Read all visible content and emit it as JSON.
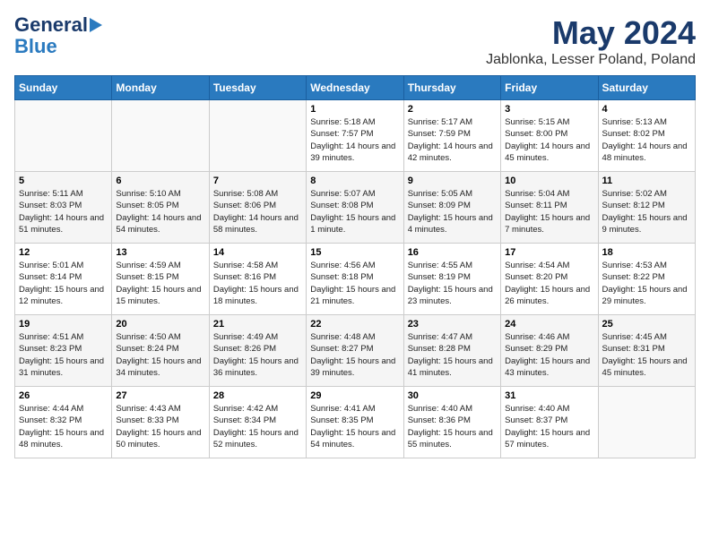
{
  "header": {
    "logo_general": "General",
    "logo_blue": "Blue",
    "month": "May 2024",
    "location": "Jablonka, Lesser Poland, Poland"
  },
  "weekdays": [
    "Sunday",
    "Monday",
    "Tuesday",
    "Wednesday",
    "Thursday",
    "Friday",
    "Saturday"
  ],
  "weeks": [
    [
      {
        "day": "",
        "info": ""
      },
      {
        "day": "",
        "info": ""
      },
      {
        "day": "",
        "info": ""
      },
      {
        "day": "1",
        "info": "Sunrise: 5:18 AM\nSunset: 7:57 PM\nDaylight: 14 hours\nand 39 minutes."
      },
      {
        "day": "2",
        "info": "Sunrise: 5:17 AM\nSunset: 7:59 PM\nDaylight: 14 hours\nand 42 minutes."
      },
      {
        "day": "3",
        "info": "Sunrise: 5:15 AM\nSunset: 8:00 PM\nDaylight: 14 hours\nand 45 minutes."
      },
      {
        "day": "4",
        "info": "Sunrise: 5:13 AM\nSunset: 8:02 PM\nDaylight: 14 hours\nand 48 minutes."
      }
    ],
    [
      {
        "day": "5",
        "info": "Sunrise: 5:11 AM\nSunset: 8:03 PM\nDaylight: 14 hours\nand 51 minutes."
      },
      {
        "day": "6",
        "info": "Sunrise: 5:10 AM\nSunset: 8:05 PM\nDaylight: 14 hours\nand 54 minutes."
      },
      {
        "day": "7",
        "info": "Sunrise: 5:08 AM\nSunset: 8:06 PM\nDaylight: 14 hours\nand 58 minutes."
      },
      {
        "day": "8",
        "info": "Sunrise: 5:07 AM\nSunset: 8:08 PM\nDaylight: 15 hours\nand 1 minute."
      },
      {
        "day": "9",
        "info": "Sunrise: 5:05 AM\nSunset: 8:09 PM\nDaylight: 15 hours\nand 4 minutes."
      },
      {
        "day": "10",
        "info": "Sunrise: 5:04 AM\nSunset: 8:11 PM\nDaylight: 15 hours\nand 7 minutes."
      },
      {
        "day": "11",
        "info": "Sunrise: 5:02 AM\nSunset: 8:12 PM\nDaylight: 15 hours\nand 9 minutes."
      }
    ],
    [
      {
        "day": "12",
        "info": "Sunrise: 5:01 AM\nSunset: 8:14 PM\nDaylight: 15 hours\nand 12 minutes."
      },
      {
        "day": "13",
        "info": "Sunrise: 4:59 AM\nSunset: 8:15 PM\nDaylight: 15 hours\nand 15 minutes."
      },
      {
        "day": "14",
        "info": "Sunrise: 4:58 AM\nSunset: 8:16 PM\nDaylight: 15 hours\nand 18 minutes."
      },
      {
        "day": "15",
        "info": "Sunrise: 4:56 AM\nSunset: 8:18 PM\nDaylight: 15 hours\nand 21 minutes."
      },
      {
        "day": "16",
        "info": "Sunrise: 4:55 AM\nSunset: 8:19 PM\nDaylight: 15 hours\nand 23 minutes."
      },
      {
        "day": "17",
        "info": "Sunrise: 4:54 AM\nSunset: 8:20 PM\nDaylight: 15 hours\nand 26 minutes."
      },
      {
        "day": "18",
        "info": "Sunrise: 4:53 AM\nSunset: 8:22 PM\nDaylight: 15 hours\nand 29 minutes."
      }
    ],
    [
      {
        "day": "19",
        "info": "Sunrise: 4:51 AM\nSunset: 8:23 PM\nDaylight: 15 hours\nand 31 minutes."
      },
      {
        "day": "20",
        "info": "Sunrise: 4:50 AM\nSunset: 8:24 PM\nDaylight: 15 hours\nand 34 minutes."
      },
      {
        "day": "21",
        "info": "Sunrise: 4:49 AM\nSunset: 8:26 PM\nDaylight: 15 hours\nand 36 minutes."
      },
      {
        "day": "22",
        "info": "Sunrise: 4:48 AM\nSunset: 8:27 PM\nDaylight: 15 hours\nand 39 minutes."
      },
      {
        "day": "23",
        "info": "Sunrise: 4:47 AM\nSunset: 8:28 PM\nDaylight: 15 hours\nand 41 minutes."
      },
      {
        "day": "24",
        "info": "Sunrise: 4:46 AM\nSunset: 8:29 PM\nDaylight: 15 hours\nand 43 minutes."
      },
      {
        "day": "25",
        "info": "Sunrise: 4:45 AM\nSunset: 8:31 PM\nDaylight: 15 hours\nand 45 minutes."
      }
    ],
    [
      {
        "day": "26",
        "info": "Sunrise: 4:44 AM\nSunset: 8:32 PM\nDaylight: 15 hours\nand 48 minutes."
      },
      {
        "day": "27",
        "info": "Sunrise: 4:43 AM\nSunset: 8:33 PM\nDaylight: 15 hours\nand 50 minutes."
      },
      {
        "day": "28",
        "info": "Sunrise: 4:42 AM\nSunset: 8:34 PM\nDaylight: 15 hours\nand 52 minutes."
      },
      {
        "day": "29",
        "info": "Sunrise: 4:41 AM\nSunset: 8:35 PM\nDaylight: 15 hours\nand 54 minutes."
      },
      {
        "day": "30",
        "info": "Sunrise: 4:40 AM\nSunset: 8:36 PM\nDaylight: 15 hours\nand 55 minutes."
      },
      {
        "day": "31",
        "info": "Sunrise: 4:40 AM\nSunset: 8:37 PM\nDaylight: 15 hours\nand 57 minutes."
      },
      {
        "day": "",
        "info": ""
      }
    ]
  ]
}
